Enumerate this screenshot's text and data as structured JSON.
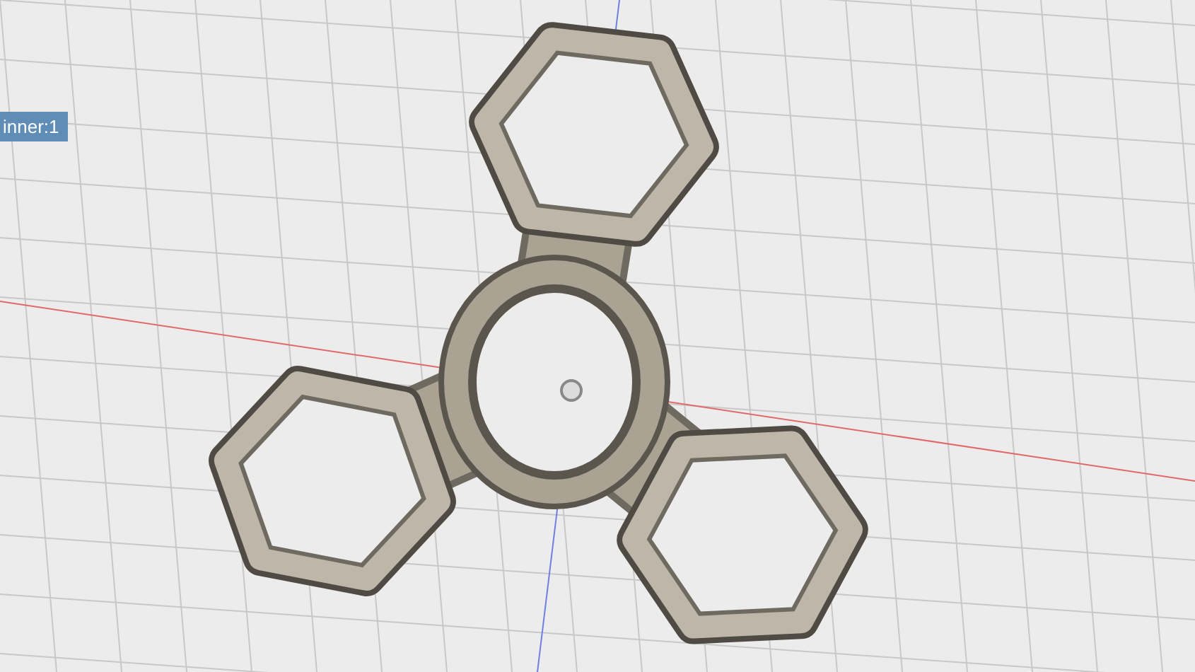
{
  "viewport": {
    "body_label": "inner:1"
  }
}
